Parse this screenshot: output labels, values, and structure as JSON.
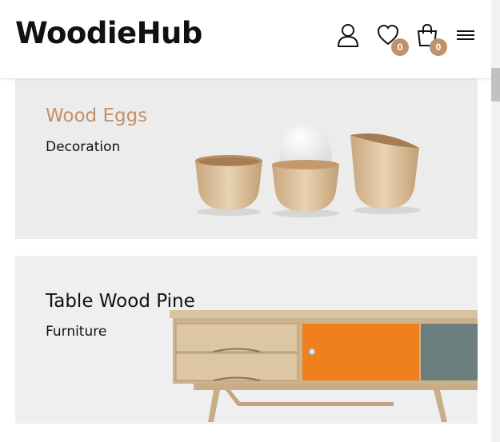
{
  "header": {
    "logo": "WoodieHub",
    "wishlist_count": "0",
    "cart_count": "0",
    "icons": [
      "user-icon",
      "heart-icon",
      "bag-icon",
      "menu-icon"
    ]
  },
  "banners": [
    {
      "title": "Wood Eggs",
      "subtitle": "Decoration",
      "title_color": "#c2916a"
    },
    {
      "title": "Table Wood Pine",
      "subtitle": "Furniture",
      "title_color": "#111111"
    }
  ],
  "colors": {
    "accent": "#c2916a",
    "badge": "#c2916a"
  }
}
